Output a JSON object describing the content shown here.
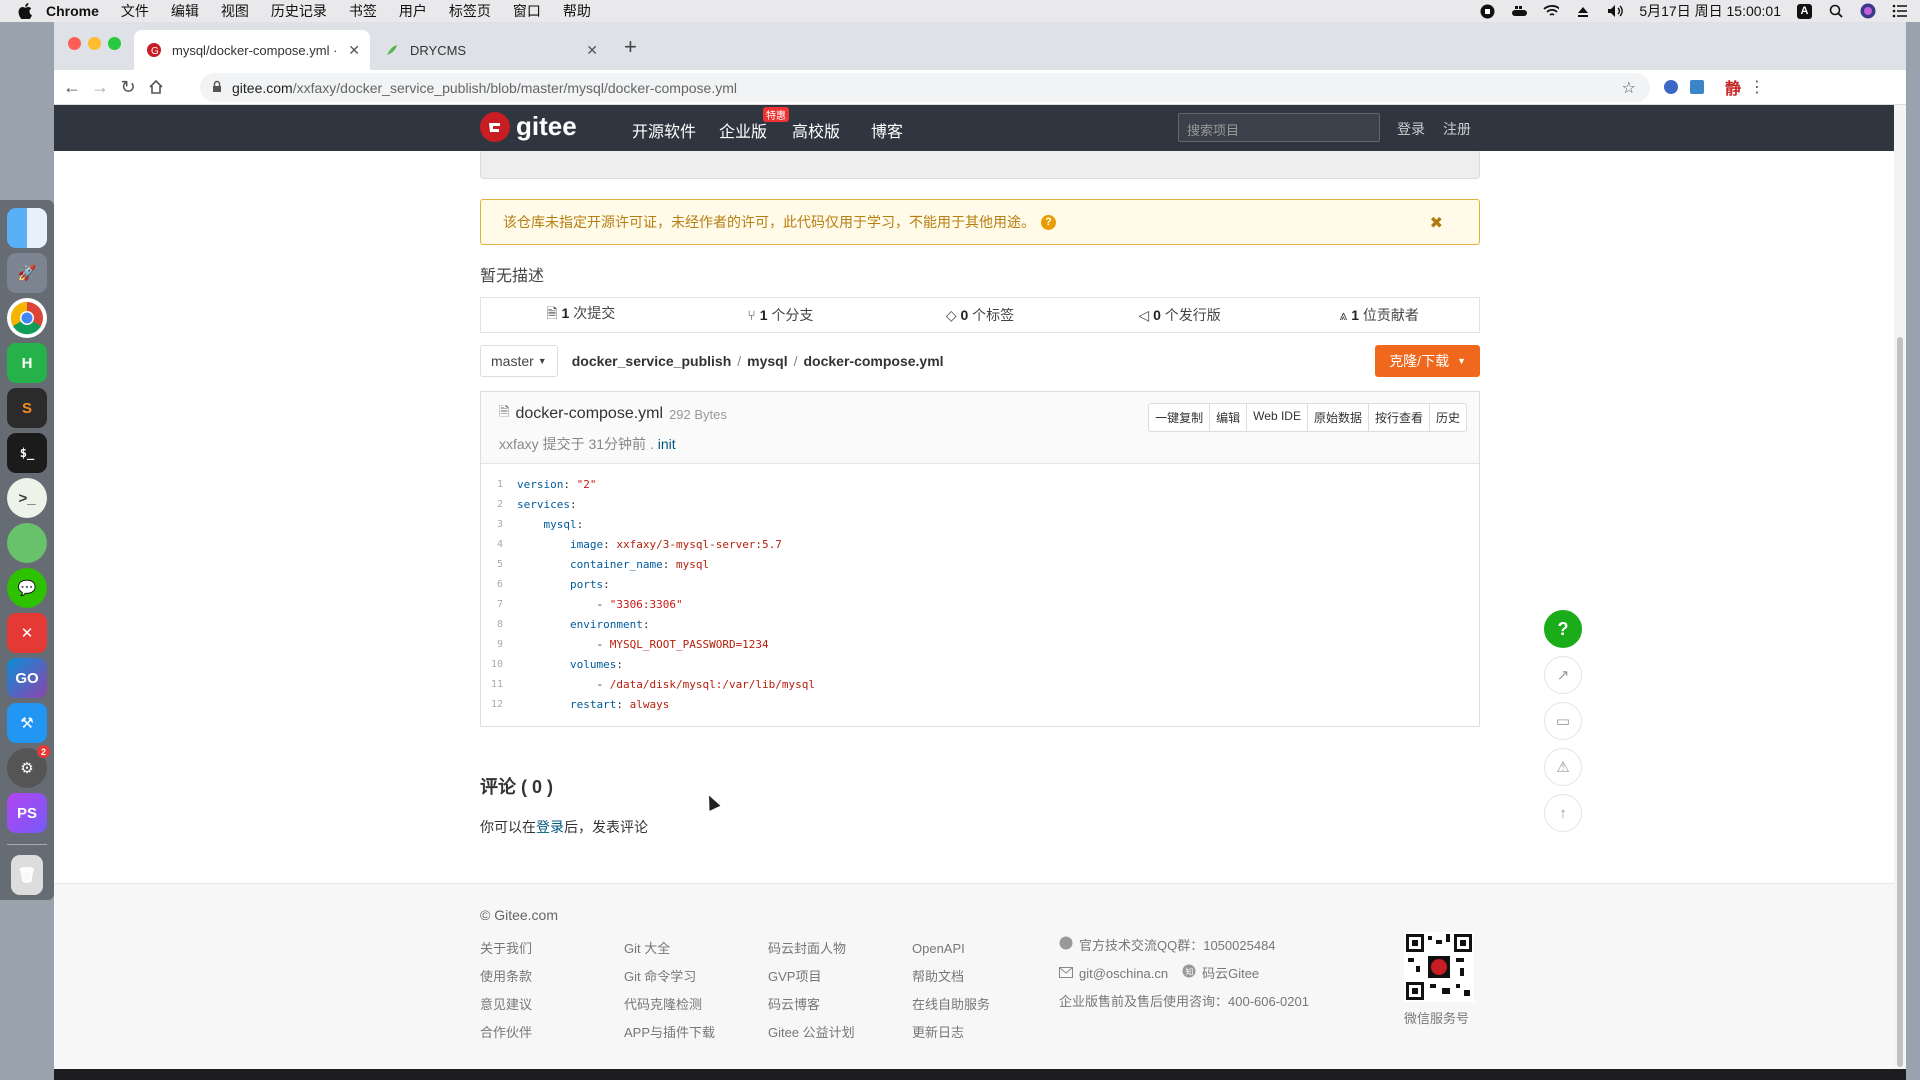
{
  "menubar": {
    "app": "Chrome",
    "items": [
      "文件",
      "编辑",
      "视图",
      "历史记录",
      "书签",
      "用户",
      "标签页",
      "窗口",
      "帮助"
    ],
    "datetime": "5月17日 周日 15:00:01",
    "input_method": "A"
  },
  "dock": {
    "apps": [
      {
        "name": "finder",
        "color": "#2e8bf0"
      },
      {
        "name": "launchpad",
        "color": "#6c7580"
      },
      {
        "name": "chrome",
        "color": "#f2f2f2"
      },
      {
        "name": "hbuilder",
        "color": "#26b24a",
        "glyph": "H"
      },
      {
        "name": "sublime",
        "color": "#f58b22",
        "glyph": "S"
      },
      {
        "name": "terminal",
        "color": "#222",
        "glyph": ">_"
      },
      {
        "name": "chat",
        "color": "#8bc34a",
        "glyph": "..."
      },
      {
        "name": "evernote",
        "color": "#5fbf5f",
        "glyph": ""
      },
      {
        "name": "wechat",
        "color": "#2dc100",
        "glyph": ""
      },
      {
        "name": "xmind",
        "color": "#e53935",
        "glyph": "✕"
      },
      {
        "name": "goland",
        "color": "#1e88e5",
        "glyph": "GO"
      },
      {
        "name": "xcode",
        "color": "#2196f3",
        "glyph": ""
      },
      {
        "name": "system-preferences",
        "color": "#777",
        "glyph": "⚙",
        "badge": "2"
      },
      {
        "name": "phpstorm",
        "color": "#8e44ad",
        "glyph": "PS"
      }
    ]
  },
  "browser": {
    "tabs": [
      {
        "title": "mysql/docker-compose.yml · ",
        "active": true
      },
      {
        "title": "DRYCMS",
        "active": false
      }
    ],
    "url_host": "gitee.com",
    "url_path": "/xxfaxy/docker_service_publish/blob/master/mysql/docker-compose.yml",
    "ime_label": "静"
  },
  "gitee": {
    "logo_text": "gitee",
    "nav": [
      "开源软件",
      "企业版",
      "高校版",
      "博客"
    ],
    "hot_badge": "特惠",
    "search_placeholder": "搜索项目",
    "login": "登录",
    "register": "注册"
  },
  "repo": {
    "license_warning": "该仓库未指定开源许可证，未经作者的许可，此代码仅用于学习，不能用于其他用途。",
    "description": "暂无描述",
    "stats": [
      {
        "count": "1",
        "label": "次提交",
        "icon": "commit-icon"
      },
      {
        "count": "1",
        "label": "个分支",
        "icon": "branch-icon"
      },
      {
        "count": "0",
        "label": "个标签",
        "icon": "tag-icon"
      },
      {
        "count": "0",
        "label": "个发行版",
        "icon": "release-icon"
      },
      {
        "count": "1",
        "label": "位贡献者",
        "icon": "contributor-icon"
      }
    ],
    "branch": "master",
    "breadcrumb": [
      "docker_service_publish",
      "mysql",
      "docker-compose.yml"
    ],
    "clone_button": "克隆/下载"
  },
  "file": {
    "name": "docker-compose.yml",
    "size": "292 Bytes",
    "author": "xxfaxy",
    "commit_prefix": "提交于 31分钟前 .",
    "commit_msg": "init",
    "buttons": [
      "一键复制",
      "编辑",
      "Web IDE",
      "原始数据",
      "按行查看",
      "历史"
    ],
    "lines": [
      {
        "n": "1",
        "indent": "",
        "key": "version",
        "sep": ": ",
        "val": "\"2\""
      },
      {
        "n": "2",
        "indent": "",
        "key": "services",
        "sep": ":",
        "val": ""
      },
      {
        "n": "3",
        "indent": "    ",
        "key": "mysql",
        "sep": ":",
        "val": ""
      },
      {
        "n": "4",
        "indent": "        ",
        "key": "image",
        "sep": ": ",
        "val": "xxfaxy/3-mysql-server:5.7"
      },
      {
        "n": "5",
        "indent": "        ",
        "key": "container_name",
        "sep": ": ",
        "val": "mysql"
      },
      {
        "n": "6",
        "indent": "        ",
        "key": "ports",
        "sep": ":",
        "val": ""
      },
      {
        "n": "7",
        "indent": "            ",
        "key": "",
        "sep": "- ",
        "val": "\"3306:3306\""
      },
      {
        "n": "8",
        "indent": "        ",
        "key": "environment",
        "sep": ":",
        "val": ""
      },
      {
        "n": "9",
        "indent": "            ",
        "key": "",
        "sep": "- ",
        "val": "MYSQL_ROOT_PASSWORD=1234"
      },
      {
        "n": "10",
        "indent": "        ",
        "key": "volumes",
        "sep": ":",
        "val": ""
      },
      {
        "n": "11",
        "indent": "            ",
        "key": "",
        "sep": "- ",
        "val": "/data/disk/mysql:/var/lib/mysql"
      },
      {
        "n": "12",
        "indent": "        ",
        "key": "restart",
        "sep": ": ",
        "val": "always"
      }
    ]
  },
  "comments": {
    "title": "评论 ( 0 )",
    "note_prefix": "你可以在",
    "login_link": "登录",
    "note_suffix": "后，发表评论"
  },
  "footer": {
    "copyright": "© Gitee.com",
    "col1": [
      "关于我们",
      "使用条款",
      "意见建议",
      "合作伙伴"
    ],
    "col2": [
      "Git 大全",
      "Git 命令学习",
      "代码克隆检测",
      "APP与插件下载"
    ],
    "col3": [
      "码云封面人物",
      "GVP项目",
      "码云博客",
      "Gitee 公益计划"
    ],
    "col4": [
      "OpenAPI",
      "帮助文档",
      "在线自助服务",
      "更新日志"
    ],
    "qq": "官方技术交流QQ群：1050025484",
    "email": "git@oschina.cn",
    "zhihu": "码云Gitee",
    "sales": "企业版售前及售后使用咨询：400-606-0201",
    "qr_label": "微信服务号"
  }
}
